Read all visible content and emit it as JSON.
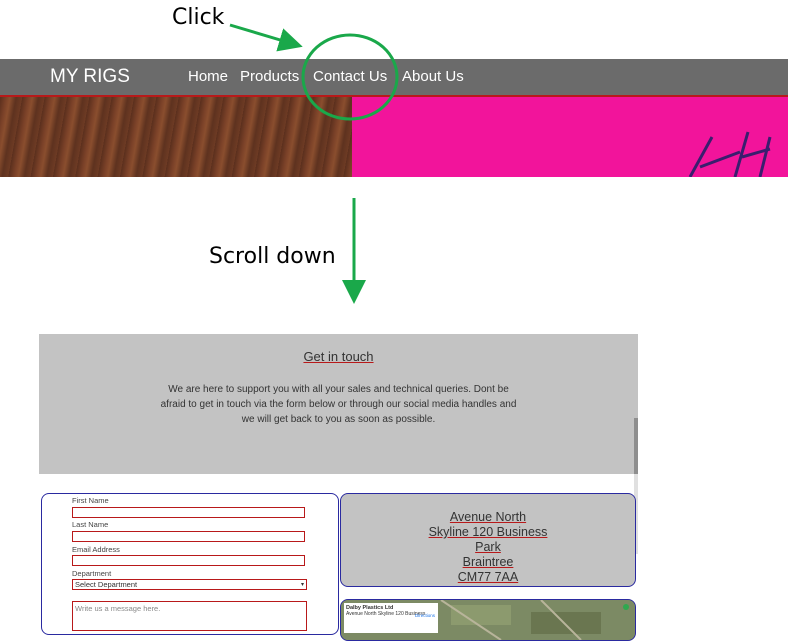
{
  "annotations": {
    "click_label": "Click",
    "scroll_label": "Scroll down"
  },
  "navbar": {
    "brand": "MY RIGS",
    "links": [
      "Home",
      "Products",
      "Contact Us",
      "About Us"
    ]
  },
  "contact": {
    "title": "Get in touch",
    "description": "We are here to support you with all your sales and technical queries. Dont be afraid to get in touch via the form below or through our social media handles and we will get back to you as soon as possible."
  },
  "form": {
    "first_name_label": "First Name",
    "last_name_label": "Last Name",
    "email_label": "Email Address",
    "department_label": "Department",
    "department_value": "Select Department",
    "message_placeholder": "Write us a message here."
  },
  "address": {
    "lines": [
      "Avenue North",
      "Skyline 120 Business",
      "Park",
      "Braintree",
      "CM77 7AA"
    ]
  },
  "map": {
    "place_name": "Dalby Plastics Ltd",
    "place_address": "Avenue North Skyline 120 Business",
    "directions_label": "Directions"
  },
  "colors": {
    "annotation_green": "#1aa84a",
    "navbar_bg": "#6b6b6b",
    "accent_red": "#b8191a",
    "panel_grey": "#c3c3c3",
    "border_blue": "#2a2aa0",
    "hero_pink": "#f2149b"
  }
}
